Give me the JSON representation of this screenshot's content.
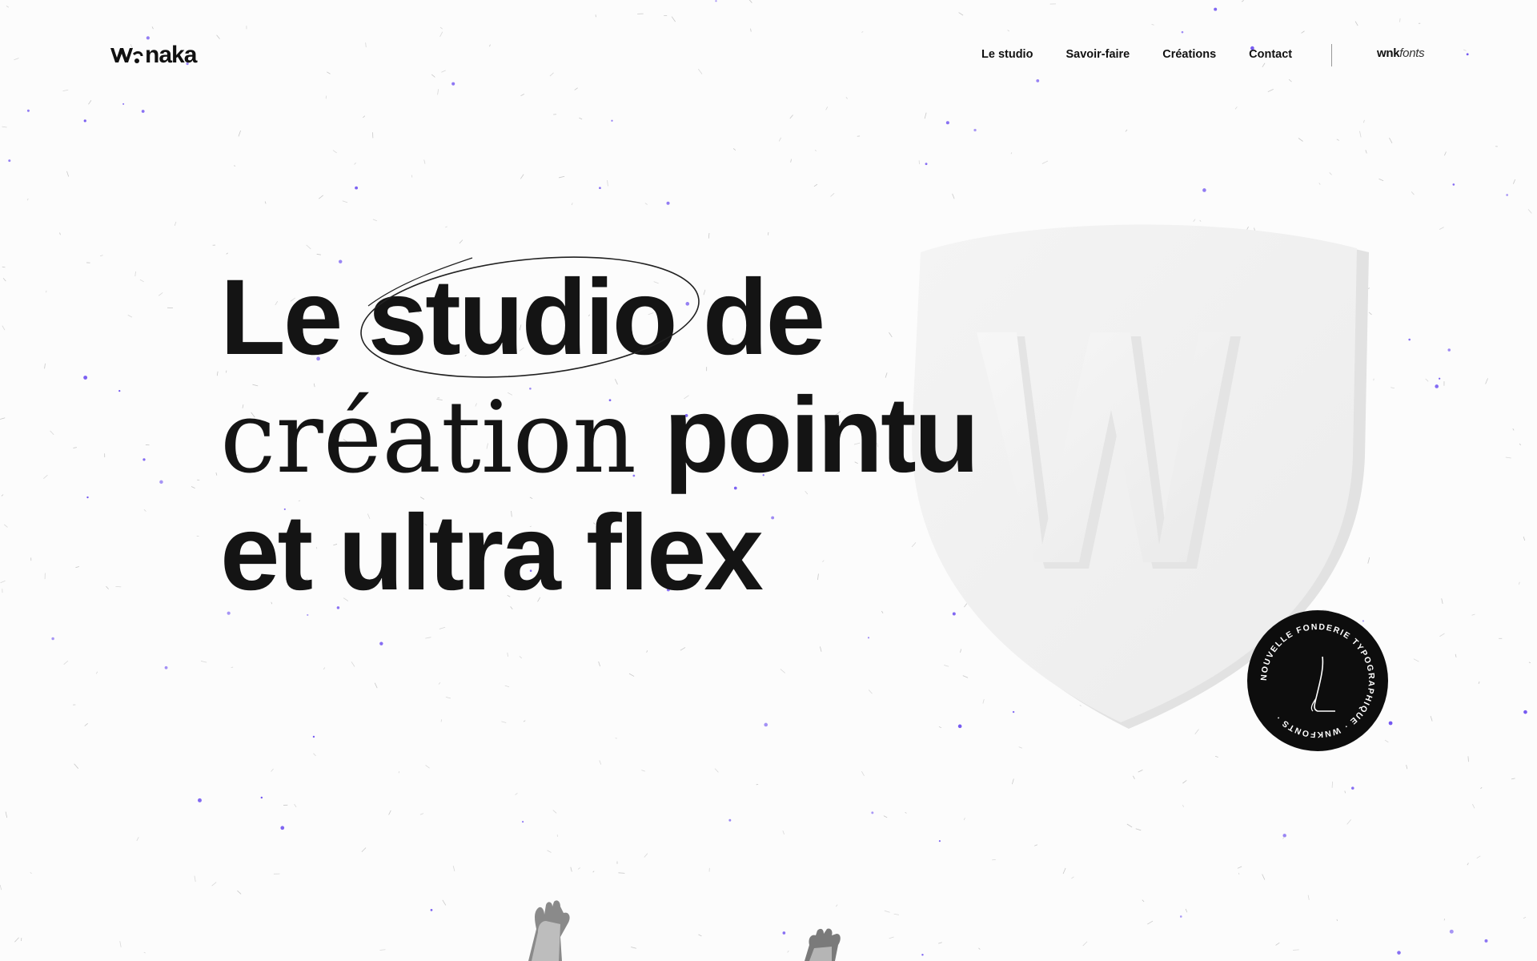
{
  "header": {
    "logo_text": "naka",
    "nav": [
      {
        "label": "Le studio"
      },
      {
        "label": "Savoir-faire"
      },
      {
        "label": "Créations"
      },
      {
        "label": "Contact"
      }
    ],
    "fonts_link_bold": "wnk",
    "fonts_link_italic": "fonts"
  },
  "hero": {
    "line1_a": "Le ",
    "line1_b": "studio",
    "line1_c": " de",
    "line2_a": "création",
    "line2_b": " pointu",
    "line3": "et ultra flex"
  },
  "badge": {
    "ring_text": "NOUVELLE FONDERIE TYPOGRAPHIQUE · WNKFONTS · "
  },
  "colors": {
    "accent": "#6a4cf0",
    "text": "#141414",
    "background": "#fcfcfc",
    "badge": "#0d0d0d"
  }
}
